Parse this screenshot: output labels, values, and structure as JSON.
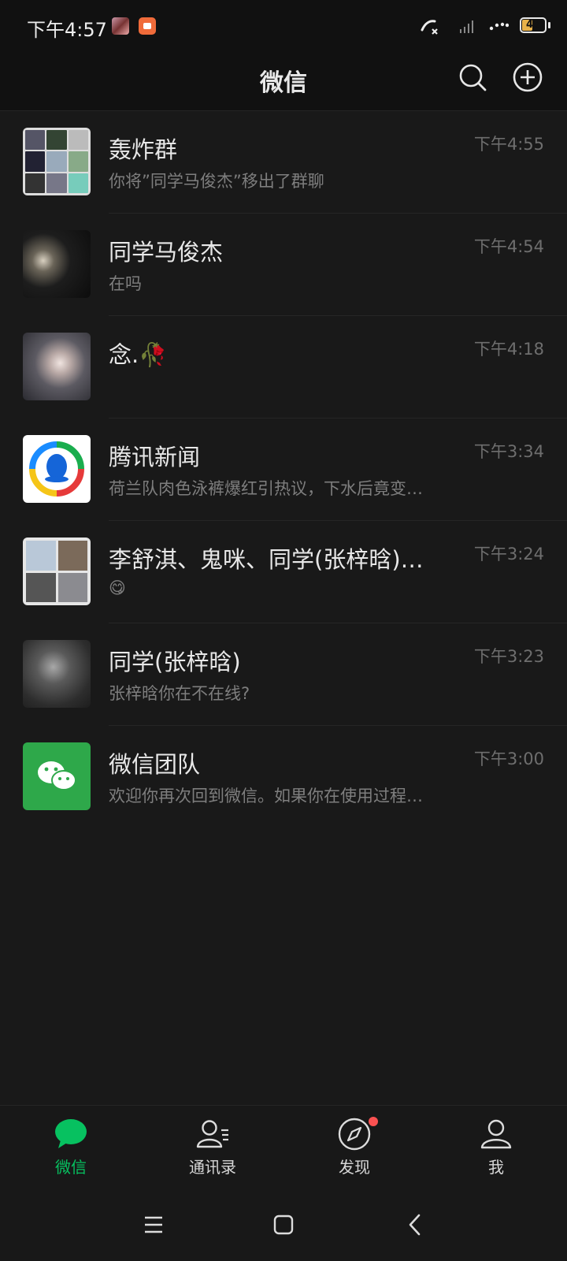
{
  "status_bar": {
    "time": "下午4:57",
    "battery": "43"
  },
  "header": {
    "title": "微信"
  },
  "chats": [
    {
      "name": "轰炸群",
      "preview": "你将”同学马俊杰”移出了群聊",
      "time": "下午4:55"
    },
    {
      "name": "同学马俊杰",
      "preview": "在吗",
      "time": "下午4:54"
    },
    {
      "name": "念.🥀",
      "preview": "",
      "time": "下午4:18"
    },
    {
      "name": "腾讯新闻",
      "preview": "荷兰队肉色泳裤爆红引热议，下水后竟变…",
      "time": "下午3:34"
    },
    {
      "name": "李舒淇、鬼咪、同学(张梓晗)…",
      "preview": "😋",
      "time": "下午3:24"
    },
    {
      "name": "同学(张梓晗)",
      "preview": "张梓晗你在不在线?",
      "time": "下午3:23"
    },
    {
      "name": "微信团队",
      "preview": "欢迎你再次回到微信。如果你在使用过程…",
      "time": "下午3:00"
    }
  ],
  "nav": {
    "chats": "微信",
    "contacts": "通讯录",
    "discover": "发现",
    "me": "我"
  },
  "colors": {
    "accent": "#07c160",
    "background": "#191919",
    "badge": "#fa5151"
  }
}
